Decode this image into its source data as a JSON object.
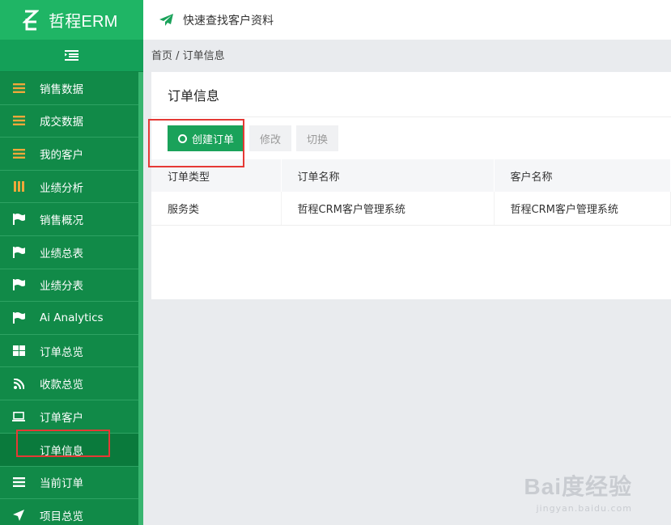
{
  "brand": {
    "name": "哲程ERM"
  },
  "topbar": {
    "quick_link": "快速查找客户资料"
  },
  "breadcrumb": "首页 / 订单信息",
  "sidebar": {
    "items": [
      {
        "label": "销售数据",
        "icon": "list-icon"
      },
      {
        "label": "成交数据",
        "icon": "list-icon"
      },
      {
        "label": "我的客户",
        "icon": "list-icon"
      },
      {
        "label": "业绩分析",
        "icon": "bars-icon"
      },
      {
        "label": "销售概况",
        "icon": "flag-icon"
      },
      {
        "label": "业绩总表",
        "icon": "flag-icon"
      },
      {
        "label": "业绩分表",
        "icon": "flag-icon"
      },
      {
        "label": "Ai Analytics",
        "icon": "flag-icon"
      },
      {
        "label": "订单总览",
        "icon": "grid-icon"
      },
      {
        "label": "收款总览",
        "icon": "rss-icon"
      },
      {
        "label": "订单客户",
        "icon": "laptop-icon"
      },
      {
        "label": "订单信息",
        "icon": "",
        "sub": true,
        "active": true
      },
      {
        "label": "当前订单",
        "icon": "menu-icon"
      },
      {
        "label": "项目总览",
        "icon": "location-arrow-icon"
      }
    ]
  },
  "panel": {
    "title": "订单信息",
    "buttons": {
      "create": "创建订单",
      "edit": "修改",
      "switch": "切换"
    },
    "columns": [
      "订单类型",
      "订单名称",
      "客户名称"
    ],
    "rows": [
      [
        "服务类",
        "哲程CRM客户管理系统",
        "哲程CRM客户管理系统"
      ]
    ]
  },
  "watermark": {
    "main": "Bai度经验",
    "sub": "jingyan.baidu.com"
  },
  "colors": {
    "sidebar": "#118a48",
    "brand": "#1fb565",
    "accent": "#1aa25a",
    "icon_orange": "#f0a83a",
    "highlight": "#e53935"
  }
}
